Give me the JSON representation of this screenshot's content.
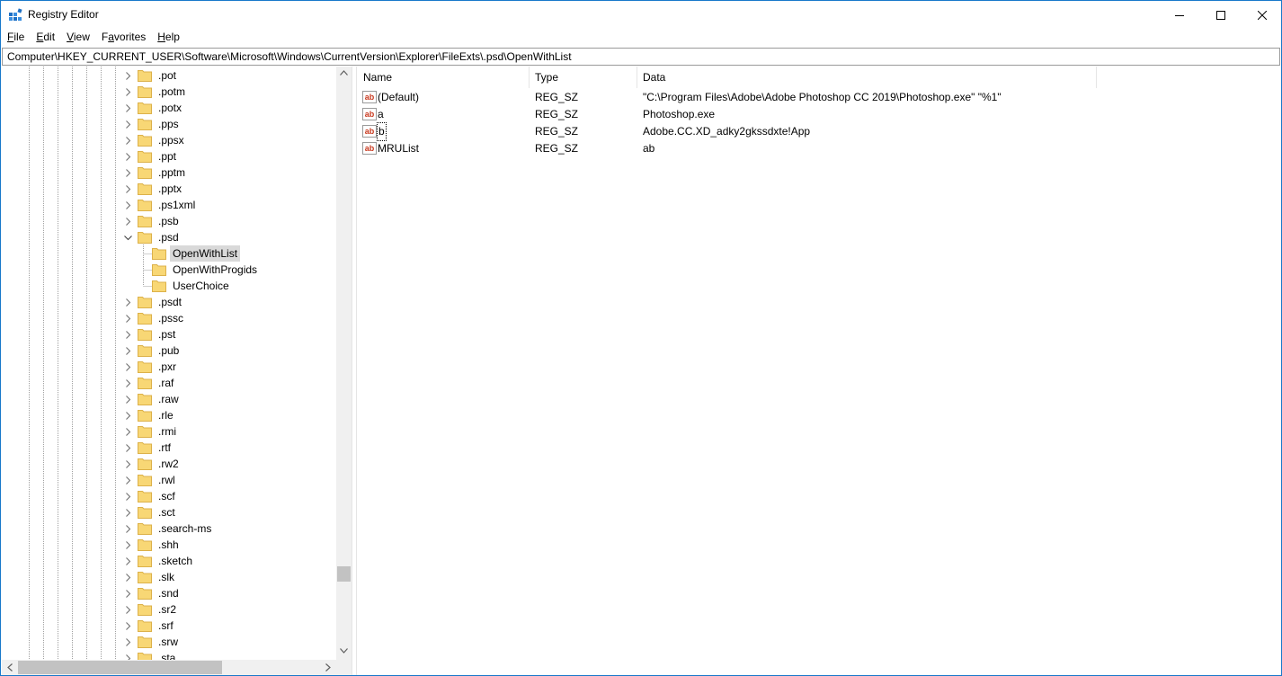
{
  "window": {
    "title": "Registry Editor",
    "accent": "#1979ca"
  },
  "menu": [
    {
      "label": "File",
      "accel": "F"
    },
    {
      "label": "Edit",
      "accel": "E"
    },
    {
      "label": "View",
      "accel": "V"
    },
    {
      "label": "Favorites",
      "accel": "a"
    },
    {
      "label": "Help",
      "accel": "H"
    }
  ],
  "address": "Computer\\HKEY_CURRENT_USER\\Software\\Microsoft\\Windows\\CurrentVersion\\Explorer\\FileExts\\.psd\\OpenWithList",
  "tree": {
    "items": [
      {
        "label": ".pot",
        "level": 0,
        "expander": "collapsed"
      },
      {
        "label": ".potm",
        "level": 0,
        "expander": "collapsed"
      },
      {
        "label": ".potx",
        "level": 0,
        "expander": "collapsed"
      },
      {
        "label": ".pps",
        "level": 0,
        "expander": "collapsed"
      },
      {
        "label": ".ppsx",
        "level": 0,
        "expander": "collapsed"
      },
      {
        "label": ".ppt",
        "level": 0,
        "expander": "collapsed"
      },
      {
        "label": ".pptm",
        "level": 0,
        "expander": "collapsed"
      },
      {
        "label": ".pptx",
        "level": 0,
        "expander": "collapsed"
      },
      {
        "label": ".ps1xml",
        "level": 0,
        "expander": "collapsed"
      },
      {
        "label": ".psb",
        "level": 0,
        "expander": "collapsed"
      },
      {
        "label": ".psd",
        "level": 0,
        "expander": "expanded"
      },
      {
        "label": "OpenWithList",
        "level": 1,
        "expander": "none",
        "selected": true
      },
      {
        "label": "OpenWithProgids",
        "level": 1,
        "expander": "none"
      },
      {
        "label": "UserChoice",
        "level": 1,
        "expander": "none"
      },
      {
        "label": ".psdt",
        "level": 0,
        "expander": "collapsed"
      },
      {
        "label": ".pssc",
        "level": 0,
        "expander": "collapsed"
      },
      {
        "label": ".pst",
        "level": 0,
        "expander": "collapsed"
      },
      {
        "label": ".pub",
        "level": 0,
        "expander": "collapsed"
      },
      {
        "label": ".pxr",
        "level": 0,
        "expander": "collapsed"
      },
      {
        "label": ".raf",
        "level": 0,
        "expander": "collapsed"
      },
      {
        "label": ".raw",
        "level": 0,
        "expander": "collapsed"
      },
      {
        "label": ".rle",
        "level": 0,
        "expander": "collapsed"
      },
      {
        "label": ".rmi",
        "level": 0,
        "expander": "collapsed"
      },
      {
        "label": ".rtf",
        "level": 0,
        "expander": "collapsed"
      },
      {
        "label": ".rw2",
        "level": 0,
        "expander": "collapsed"
      },
      {
        "label": ".rwl",
        "level": 0,
        "expander": "collapsed"
      },
      {
        "label": ".scf",
        "level": 0,
        "expander": "collapsed"
      },
      {
        "label": ".sct",
        "level": 0,
        "expander": "collapsed"
      },
      {
        "label": ".search-ms",
        "level": 0,
        "expander": "collapsed"
      },
      {
        "label": ".shh",
        "level": 0,
        "expander": "collapsed"
      },
      {
        "label": ".sketch",
        "level": 0,
        "expander": "collapsed"
      },
      {
        "label": ".slk",
        "level": 0,
        "expander": "collapsed"
      },
      {
        "label": ".snd",
        "level": 0,
        "expander": "collapsed"
      },
      {
        "label": ".sr2",
        "level": 0,
        "expander": "collapsed"
      },
      {
        "label": ".srf",
        "level": 0,
        "expander": "collapsed"
      },
      {
        "label": ".srw",
        "level": 0,
        "expander": "collapsed"
      },
      {
        "label": ".sta",
        "level": 0,
        "expander": "collapsed"
      }
    ]
  },
  "list": {
    "columns": {
      "name": "Name",
      "type": "Type",
      "data": "Data"
    },
    "rows": [
      {
        "name": "(Default)",
        "type": "REG_SZ",
        "data": "\"C:\\Program Files\\Adobe\\Adobe Photoshop CC 2019\\Photoshop.exe\" \"%1\"",
        "icon": "string-value-icon"
      },
      {
        "name": "a",
        "type": "REG_SZ",
        "data": "Photoshop.exe",
        "icon": "string-value-icon"
      },
      {
        "name": "b",
        "type": "REG_SZ",
        "data": "Adobe.CC.XD_adky2gkssdxte!App",
        "icon": "string-value-icon",
        "focused": true
      },
      {
        "name": "MRUList",
        "type": "REG_SZ",
        "data": "ab",
        "icon": "string-value-icon"
      }
    ]
  },
  "colors": {
    "folder": "#f8d775",
    "folder_edge": "#dcb14a",
    "selection": "#d9d9d9",
    "value_icon_red": "#c8381e"
  }
}
